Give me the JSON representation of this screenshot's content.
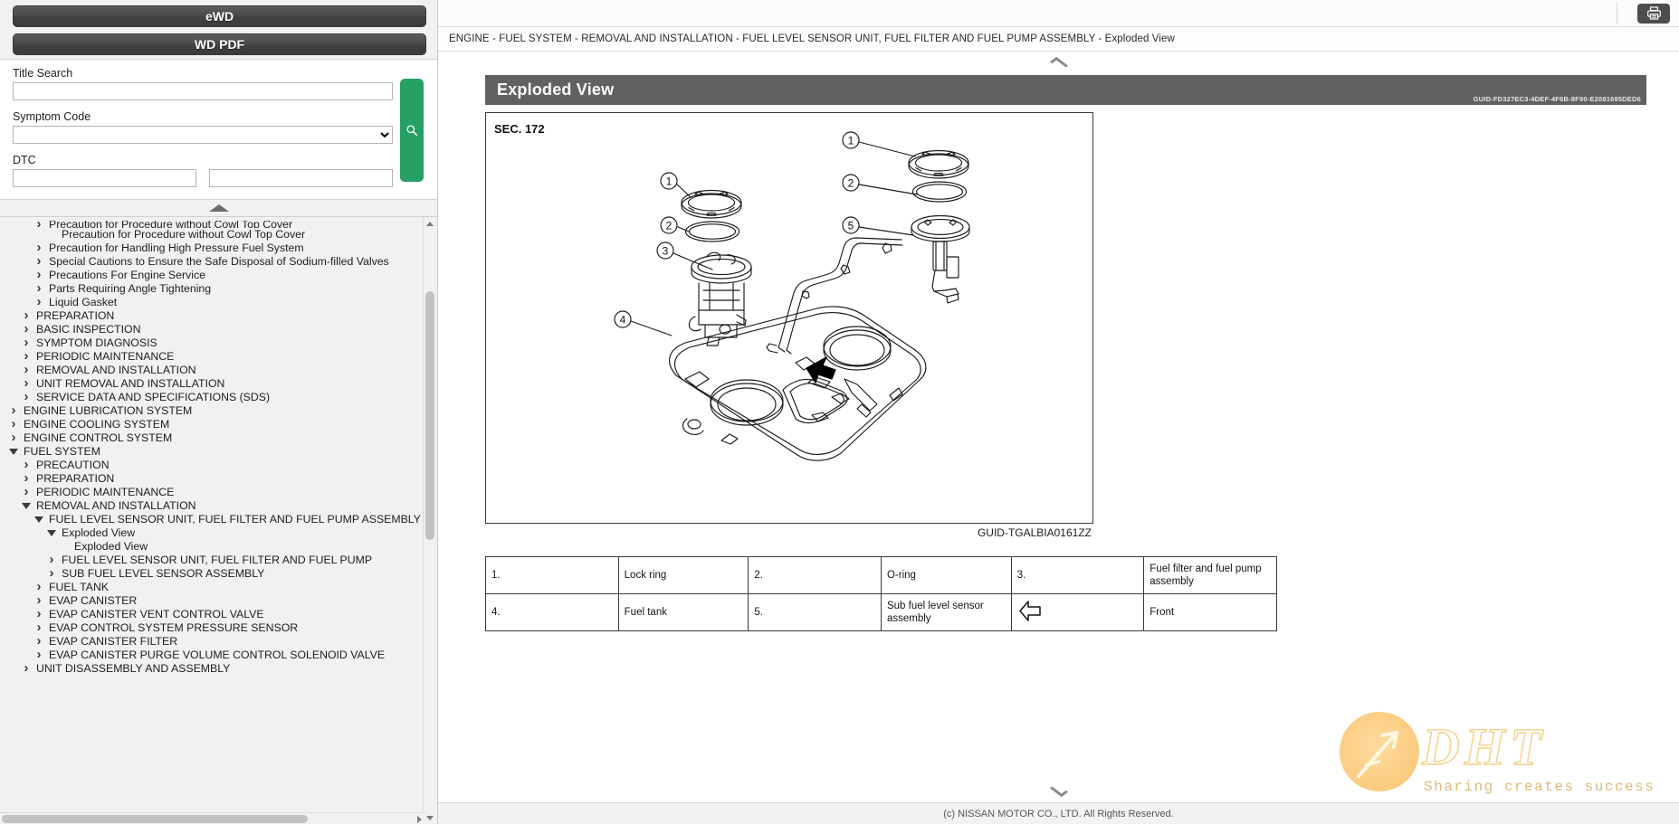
{
  "sidebar": {
    "buttons": [
      {
        "label": "eWD",
        "name": "ewd-button"
      },
      {
        "label": "WD PDF",
        "name": "wd-pdf-button"
      }
    ],
    "search": {
      "title_search_label": "Title Search",
      "title_search_value": "",
      "symptom_code_label": "Symptom Code",
      "symptom_code_value": "",
      "symptom_code_options": [
        ""
      ],
      "dtc_label": "DTC",
      "dtc_value_1": "",
      "dtc_value_2": "",
      "search_icon": "search-icon",
      "search_button_color": "#26a065"
    },
    "tree": [
      {
        "label": "Precaution for Procedure without Cowl Top Cover",
        "indent": 2,
        "state": "closed",
        "clipped": true
      },
      {
        "label": "Precaution for Procedure without Cowl Top Cover",
        "indent": 3,
        "state": "none"
      },
      {
        "label": "Precaution for Handling High Pressure Fuel System",
        "indent": 2,
        "state": "closed"
      },
      {
        "label": "Special Cautions to Ensure the Safe Disposal of Sodium-filled Valves",
        "indent": 2,
        "state": "closed"
      },
      {
        "label": "Precautions For Engine Service",
        "indent": 2,
        "state": "closed"
      },
      {
        "label": "Parts Requiring Angle Tightening",
        "indent": 2,
        "state": "closed"
      },
      {
        "label": "Liquid Gasket",
        "indent": 2,
        "state": "closed"
      },
      {
        "label": "PREPARATION",
        "indent": 1,
        "state": "closed"
      },
      {
        "label": "BASIC INSPECTION",
        "indent": 1,
        "state": "closed"
      },
      {
        "label": "SYMPTOM DIAGNOSIS",
        "indent": 1,
        "state": "closed"
      },
      {
        "label": "PERIODIC MAINTENANCE",
        "indent": 1,
        "state": "closed"
      },
      {
        "label": "REMOVAL AND INSTALLATION",
        "indent": 1,
        "state": "closed"
      },
      {
        "label": "UNIT REMOVAL AND INSTALLATION",
        "indent": 1,
        "state": "closed"
      },
      {
        "label": "SERVICE DATA AND SPECIFICATIONS (SDS)",
        "indent": 1,
        "state": "closed"
      },
      {
        "label": "ENGINE LUBRICATION SYSTEM",
        "indent": 0,
        "state": "closed"
      },
      {
        "label": "ENGINE COOLING SYSTEM",
        "indent": 0,
        "state": "closed"
      },
      {
        "label": "ENGINE CONTROL SYSTEM",
        "indent": 0,
        "state": "closed"
      },
      {
        "label": "FUEL SYSTEM",
        "indent": 0,
        "state": "open"
      },
      {
        "label": "PRECAUTION",
        "indent": 1,
        "state": "closed"
      },
      {
        "label": "PREPARATION",
        "indent": 1,
        "state": "closed"
      },
      {
        "label": "PERIODIC MAINTENANCE",
        "indent": 1,
        "state": "closed"
      },
      {
        "label": "REMOVAL AND INSTALLATION",
        "indent": 1,
        "state": "open"
      },
      {
        "label": "FUEL LEVEL SENSOR UNIT, FUEL FILTER AND FUEL PUMP ASSEMBLY",
        "indent": 2,
        "state": "open"
      },
      {
        "label": "Exploded View",
        "indent": 3,
        "state": "open"
      },
      {
        "label": "Exploded View",
        "indent": 4,
        "state": "none"
      },
      {
        "label": "FUEL LEVEL SENSOR UNIT, FUEL FILTER AND FUEL PUMP",
        "indent": 3,
        "state": "closed"
      },
      {
        "label": "SUB FUEL LEVEL SENSOR ASSEMBLY",
        "indent": 3,
        "state": "closed"
      },
      {
        "label": "FUEL TANK",
        "indent": 2,
        "state": "closed"
      },
      {
        "label": "EVAP CANISTER",
        "indent": 2,
        "state": "closed"
      },
      {
        "label": "EVAP CANISTER VENT CONTROL VALVE",
        "indent": 2,
        "state": "closed"
      },
      {
        "label": "EVAP CONTROL SYSTEM PRESSURE SENSOR",
        "indent": 2,
        "state": "closed"
      },
      {
        "label": "EVAP CANISTER FILTER",
        "indent": 2,
        "state": "closed"
      },
      {
        "label": "EVAP CANISTER PURGE VOLUME CONTROL SOLENOID VALVE",
        "indent": 2,
        "state": "closed"
      },
      {
        "label": "UNIT DISASSEMBLY AND ASSEMBLY",
        "indent": 1,
        "state": "closed"
      }
    ]
  },
  "document": {
    "breadcrumb": "ENGINE - FUEL SYSTEM - REMOVAL AND INSTALLATION - FUEL LEVEL SENSOR UNIT, FUEL FILTER AND FUEL PUMP ASSEMBLY - Exploded View",
    "print_icon": "printer-icon",
    "section_title": "Exploded View",
    "section_guid": "GUID-FD327EC3-4DEF-4F6B-8F90-E2081695DED6",
    "figure": {
      "sec_label": "SEC. 172",
      "caption": "GUID-TGALBIA0161ZZ",
      "callouts": [
        "1",
        "2",
        "3",
        "4",
        "5"
      ]
    },
    "parts_table": [
      [
        {
          "text": "1."
        },
        {
          "text": "Lock ring"
        },
        {
          "text": "2."
        },
        {
          "text": "O-ring"
        },
        {
          "text": "3."
        },
        {
          "text": "Fuel filter and fuel pump assembly"
        }
      ],
      [
        {
          "text": "4."
        },
        {
          "text": "Fuel tank"
        },
        {
          "text": "5."
        },
        {
          "text": "Sub fuel level sensor assembly"
        },
        {
          "text": "",
          "icon": "front-arrow-icon"
        },
        {
          "text": "Front"
        }
      ]
    ],
    "scroll_up_label": "scroll-up",
    "scroll_down_label": "scroll-down",
    "footer": "(c) NISSAN MOTOR CO., LTD. All Rights Reserved."
  },
  "watermark": {
    "text": "DHT",
    "tagline": "Sharing creates success"
  }
}
